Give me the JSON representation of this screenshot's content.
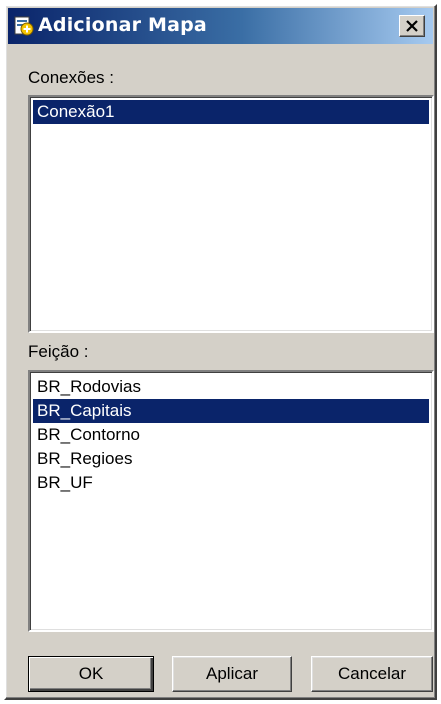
{
  "window": {
    "title": "Adicionar Mapa",
    "icon": "add-map-icon",
    "close_symbol": "close-icon"
  },
  "conexoes": {
    "label": "Conexões :",
    "items": [
      {
        "label": "Conexão1",
        "selected": true
      }
    ]
  },
  "feicao": {
    "label": "Feição :",
    "items": [
      {
        "label": "BR_Rodovias",
        "selected": false
      },
      {
        "label": "BR_Capitais",
        "selected": true
      },
      {
        "label": "BR_Contorno",
        "selected": false
      },
      {
        "label": "BR_Regioes",
        "selected": false
      },
      {
        "label": "BR_UF",
        "selected": false
      }
    ]
  },
  "buttons": {
    "ok": "OK",
    "aplicar": "Aplicar",
    "cancelar": "Cancelar"
  },
  "colors": {
    "title_bar_start": "#0a246a",
    "title_bar_end": "#a6caf0",
    "selection": "#0a246a",
    "face": "#d4d0c8"
  }
}
